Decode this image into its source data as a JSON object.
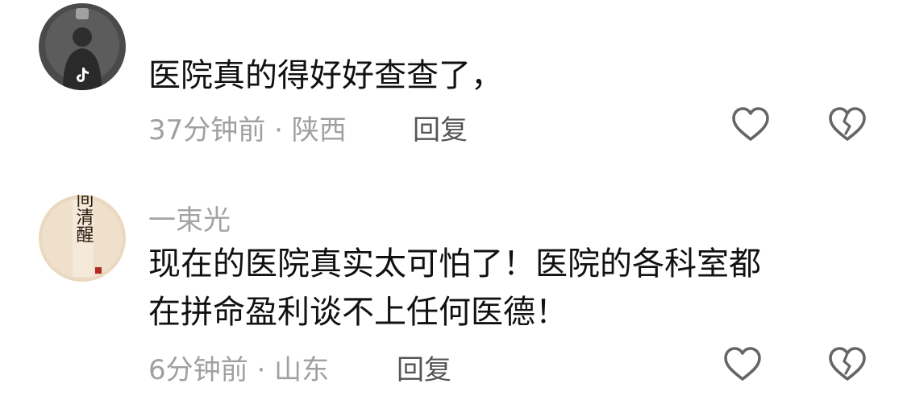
{
  "comments": [
    {
      "username": "",
      "text_lines": [
        "医院真的得好好查查了，"
      ],
      "time": "37分钟前",
      "separator": "·",
      "location": "陕西",
      "reply_label": "回复",
      "avatar_icon": "tiktok-logo-icon",
      "like_icon": "heart-outline-icon",
      "dislike_icon": "broken-heart-outline-icon"
    },
    {
      "username": "一束光",
      "text_lines": [
        "现在的医院真实太可怕了！医院的各科室都",
        "在拼命盈利谈不上任何医德！"
      ],
      "time": "6分钟前",
      "separator": "·",
      "location": "山东",
      "reply_label": "回复",
      "avatar_icon": "calligraphy-avatar",
      "avatar_text": "人间清醒",
      "like_icon": "heart-outline-icon",
      "dislike_icon": "broken-heart-outline-icon"
    }
  ],
  "colors": {
    "text": "#111111",
    "meta": "#a0a0a0",
    "reply": "#555555",
    "icon": "#666666"
  }
}
